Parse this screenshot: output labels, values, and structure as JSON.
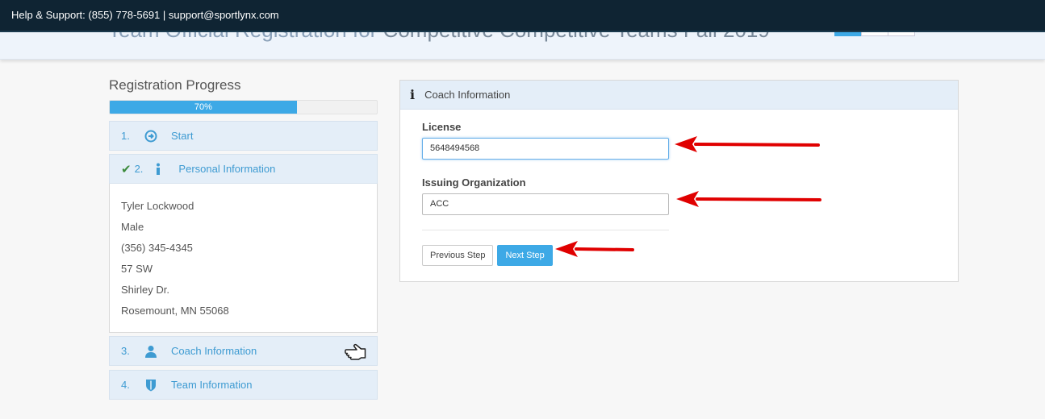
{
  "support": {
    "text": "Help & Support: (855) 778-5691 | support@sportlynx.com"
  },
  "page": {
    "title_part1": "Team Official Registration for ",
    "title_part2": "Competitive Competitive Teams Fall 2019"
  },
  "progress": {
    "title": "Registration Progress",
    "label": "70%",
    "percent": 70
  },
  "steps": [
    {
      "num": "1.",
      "label": "Start",
      "icon": "arrow-circle-right-icon"
    },
    {
      "num": "2.",
      "label": "Personal Information",
      "icon": "info-icon",
      "completed": true
    },
    {
      "num": "3.",
      "label": "Coach Information",
      "icon": "user-icon"
    },
    {
      "num": "4.",
      "label": "Team Information",
      "icon": "shield-icon"
    }
  ],
  "personal": {
    "name": "Tyler Lockwood",
    "gender": "Male",
    "phone": "(356) 345-4345",
    "address1": "57 SW",
    "address2": "Shirley Dr.",
    "city": "Rosemount, MN 55068"
  },
  "panel": {
    "title": "Coach Information"
  },
  "form": {
    "license_label": "License",
    "license_value": "5648494568",
    "org_label": "Issuing Organization",
    "org_value": "ACC",
    "prev_label": "Previous Step",
    "next_label": "Next Step"
  },
  "colors": {
    "accent": "#3da9e6",
    "topbar": "#0f2433",
    "arrow": "#e00000"
  }
}
